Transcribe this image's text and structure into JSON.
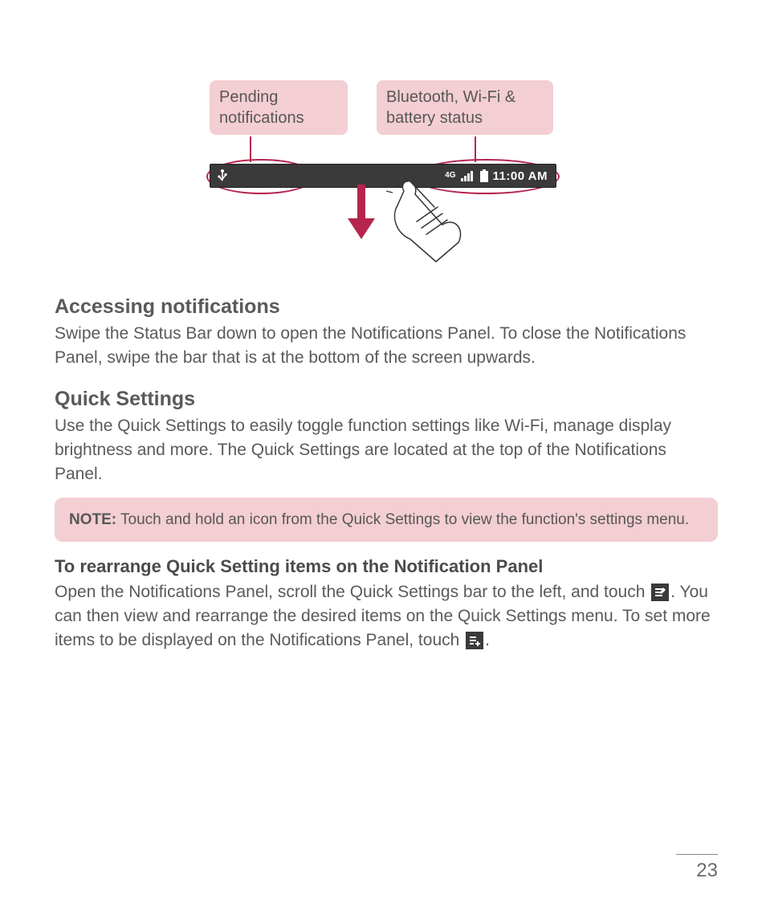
{
  "diagram": {
    "callout_left": "Pending notifications",
    "callout_right": "Bluetooth, Wi-Fi & battery status",
    "statusbar": {
      "network": "4G",
      "time": "11:00 AM"
    }
  },
  "section1": {
    "heading": "Accessing notifications",
    "body": "Swipe the Status Bar down to open the Notifications Panel. To close the Notifications Panel, swipe the bar that is at the bottom of the screen upwards."
  },
  "section2": {
    "heading": "Quick Settings",
    "body": "Use the Quick Settings to easily toggle function settings like Wi-Fi, manage display brightness and more. The Quick Settings are located at the top of the Notifications Panel."
  },
  "note": {
    "label": "NOTE:",
    "text": " Touch and hold an icon from the Quick Settings to view the function's settings menu."
  },
  "section3": {
    "heading": "To rearrange Quick Setting items on the Notification Panel",
    "body_pre": "Open the Notifications Panel, scroll the Quick Settings bar to the left, and touch ",
    "body_mid": ". You can then view and rearrange the desired items on the Quick Settings menu. To set more items to be displayed on the Notifications Panel, touch ",
    "body_post": "."
  },
  "page_number": "23"
}
